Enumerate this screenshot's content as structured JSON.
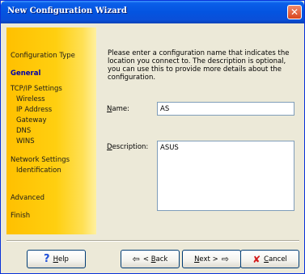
{
  "window": {
    "title": "New Configuration Wizard",
    "close_glyph": "✕"
  },
  "sidebar": {
    "items": [
      {
        "label": "Configuration Type",
        "level": "top",
        "active": false
      },
      {
        "label": "General",
        "level": "top",
        "active": true
      },
      {
        "label": "TCP/IP Settings",
        "level": "top",
        "active": false
      },
      {
        "label": "Wireless",
        "level": "sub",
        "active": false
      },
      {
        "label": "IP Address",
        "level": "sub",
        "active": false
      },
      {
        "label": "Gateway",
        "level": "sub",
        "active": false
      },
      {
        "label": "DNS",
        "level": "sub",
        "active": false
      },
      {
        "label": "WINS",
        "level": "sub",
        "active": false
      },
      {
        "label": "Network Settings",
        "level": "top",
        "active": false
      },
      {
        "label": "Identification",
        "level": "sub",
        "active": false
      },
      {
        "label": "Advanced",
        "level": "top",
        "active": false
      },
      {
        "label": "Finish",
        "level": "top",
        "active": false
      }
    ]
  },
  "main": {
    "instructions": "Please enter a configuration name that indicates the location you connect to. The description is optional, you can use this to provide more details about the configuration.",
    "name": {
      "label_prefix": "N",
      "label_rest": "ame:",
      "value": "AS"
    },
    "description": {
      "label_prefix": "D",
      "label_rest": "escription:",
      "value": "ASUS"
    }
  },
  "buttons": {
    "help": {
      "icon": "?",
      "prefix": "H",
      "rest": "elp"
    },
    "back": {
      "arrow": "⇦",
      "text_before": "< ",
      "prefix": "B",
      "rest": "ack"
    },
    "next": {
      "prefix": "N",
      "rest": "ext >",
      "arrow": "⇨"
    },
    "cancel": {
      "icon": "✘",
      "prefix": "C",
      "rest": "ancel"
    }
  },
  "colors": {
    "titlebar": "#0454e0",
    "sidebar_gold": "#ffc000",
    "active_nav": "#0000a8",
    "dialog_bg": "#ece9d8"
  }
}
